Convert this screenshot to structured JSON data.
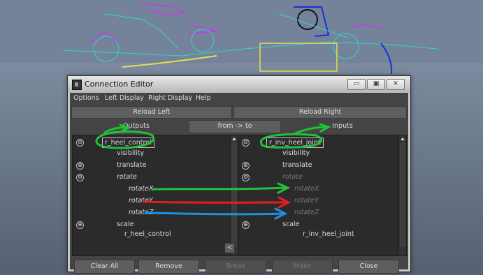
{
  "window": {
    "title": "Connection Editor",
    "buttons": [
      "▭",
      "▣",
      "✕"
    ]
  },
  "menu": [
    "Options",
    "Left Display",
    "Right Display",
    "Help"
  ],
  "reload": {
    "left": "Reload Left",
    "right": "Reload Right"
  },
  "headers": {
    "outputs": "Outputs",
    "direction": "from -> to",
    "inputs": "Inputs"
  },
  "left_list": [
    {
      "label": "r_heel_control",
      "expander": "⊖",
      "style": "sel"
    },
    {
      "label": "visibility",
      "expander": "",
      "style": ""
    },
    {
      "label": "translate",
      "expander": "⊕",
      "style": ""
    },
    {
      "label": "rotate",
      "expander": "⊖",
      "style": "it"
    },
    {
      "label": "rotateX",
      "expander": "",
      "style": "it"
    },
    {
      "label": "rotateY",
      "expander": "",
      "style": "it"
    },
    {
      "label": "rotateZ",
      "expander": "",
      "style": "it"
    },
    {
      "label": "scale",
      "expander": "⊕",
      "style": ""
    }
  ],
  "left_footer": "r_heel_control",
  "right_list": [
    {
      "label": "r_inv_heel_joint",
      "expander": "⊖",
      "style": "sel"
    },
    {
      "label": "visibility",
      "expander": "",
      "style": ""
    },
    {
      "label": "translate",
      "expander": "⊕",
      "style": ""
    },
    {
      "label": "rotate",
      "expander": "⊖",
      "style": "dim"
    },
    {
      "label": "rotateX",
      "expander": "",
      "style": "dim"
    },
    {
      "label": "rotateY",
      "expander": "",
      "style": "dim"
    },
    {
      "label": "rotateZ",
      "expander": "",
      "style": "dim"
    },
    {
      "label": "scale",
      "expander": "⊕",
      "style": ""
    }
  ],
  "right_footer": "r_inv_heel_joint",
  "nav": {
    "prev": "<",
    "next": ">"
  },
  "bottom_buttons": [
    {
      "label": "Clear All",
      "enabled": true
    },
    {
      "label": "Remove",
      "enabled": true
    },
    {
      "label": "Break",
      "enabled": false
    },
    {
      "label": "Make",
      "enabled": false
    },
    {
      "label": "Close",
      "enabled": true
    }
  ],
  "colors": {
    "green": "#22c13a",
    "red": "#e21f1f",
    "blue": "#1f8fe0"
  }
}
